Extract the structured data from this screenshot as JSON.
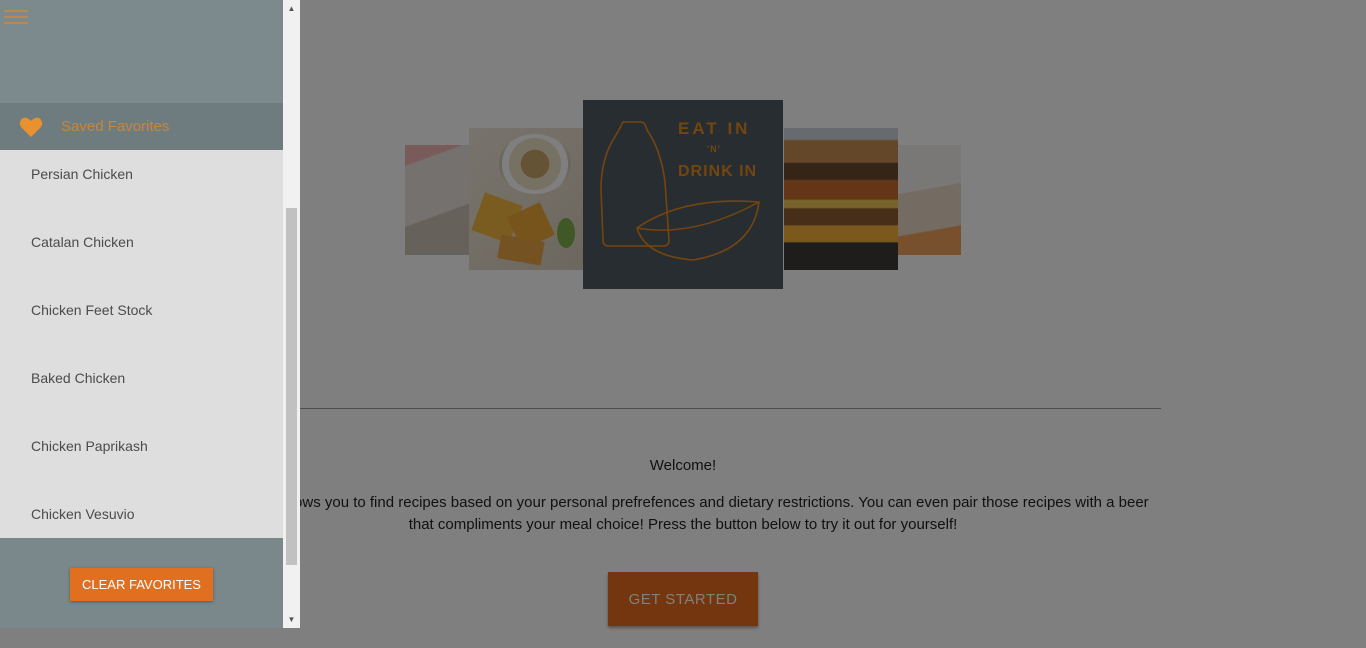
{
  "drawer": {
    "favorites_title": "Saved Favorites",
    "items": [
      {
        "label": "Persian Chicken"
      },
      {
        "label": "Catalan Chicken"
      },
      {
        "label": "Chicken Feet Stock"
      },
      {
        "label": "Baked Chicken"
      },
      {
        "label": "Chicken Paprikash"
      },
      {
        "label": "Chicken Vesuvio"
      }
    ],
    "clear_label": "CLEAR FAVORITES"
  },
  "logo": {
    "line1": "EAT IN",
    "line2": "'N'",
    "line3": "DRINK IN"
  },
  "main": {
    "welcome": "Welcome!",
    "intro": "This app allows you to find recipes based on your personal prefrefences and dietary restrictions. You can even pair those recipes with a beer that compliments your meal choice! Press the button below to try it out for yourself!",
    "cta_label": "GET STARTED"
  },
  "icons": {
    "menu": "hamburger-menu-icon",
    "favorites": "heart-icon",
    "scroll_up": "arrow-up-icon",
    "scroll_down": "arrow-down-icon"
  },
  "colors": {
    "accent": "#e66d1c",
    "drawer_header": "#7c8a8d",
    "logo_bg": "#4e5b62"
  }
}
